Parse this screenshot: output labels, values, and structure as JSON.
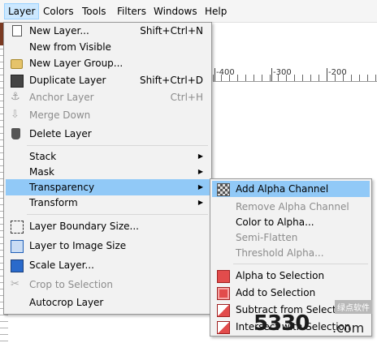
{
  "menubar": {
    "items": [
      "Layer",
      "Colors",
      "Tools",
      "Filters",
      "Windows",
      "Help"
    ]
  },
  "ruler": {
    "labels": [
      "-400",
      "-300",
      "-200"
    ]
  },
  "layer_menu": {
    "items": [
      {
        "label": "New Layer...",
        "shortcut": "Shift+Ctrl+N",
        "icon": "new-layer-icon",
        "disabled": false
      },
      {
        "label": "New from Visible",
        "shortcut": "",
        "icon": "",
        "disabled": false
      },
      {
        "label": "New Layer Group...",
        "shortcut": "",
        "icon": "folder-icon",
        "disabled": false
      },
      {
        "label": "Duplicate Layer",
        "shortcut": "Shift+Ctrl+D",
        "icon": "duplicate-layer-icon",
        "disabled": false
      },
      {
        "label": "Anchor Layer",
        "shortcut": "Ctrl+H",
        "icon": "anchor-icon",
        "disabled": true
      },
      {
        "label": "Merge Down",
        "shortcut": "",
        "icon": "merge-down-icon",
        "disabled": true
      },
      {
        "label": "Delete Layer",
        "shortcut": "",
        "icon": "trash-icon",
        "disabled": false
      },
      {
        "label": "Stack",
        "submenu": true
      },
      {
        "label": "Mask",
        "submenu": true
      },
      {
        "label": "Transparency",
        "submenu": true,
        "highlighted": true
      },
      {
        "label": "Transform",
        "submenu": true
      },
      {
        "label": "Layer Boundary Size...",
        "icon": "layer-boundary-icon"
      },
      {
        "label": "Layer to Image Size",
        "icon": "layer-to-image-icon"
      },
      {
        "label": "Scale Layer...",
        "icon": "scale-layer-icon"
      },
      {
        "label": "Crop to Selection",
        "icon": "crop-icon",
        "disabled": true
      },
      {
        "label": "Autocrop Layer"
      }
    ]
  },
  "transparency_menu": {
    "items": [
      {
        "label": "Add Alpha Channel",
        "icon": "alpha-channel-icon",
        "highlighted": true
      },
      {
        "label": "Remove Alpha Channel",
        "disabled": true
      },
      {
        "label": "Color to Alpha..."
      },
      {
        "label": "Semi-Flatten",
        "disabled": true
      },
      {
        "label": "Threshold Alpha...",
        "disabled": true
      },
      {
        "label": "Alpha to Selection",
        "icon": "alpha-to-selection-icon"
      },
      {
        "label": "Add to Selection",
        "icon": "add-to-selection-icon"
      },
      {
        "label": "Subtract from Selection",
        "icon": "subtract-selection-icon"
      },
      {
        "label": "Intersect with Selection",
        "icon": "intersect-selection-icon"
      }
    ]
  },
  "watermark": {
    "brand": "5330",
    "domain": ".com",
    "cn": "绿点软件"
  },
  "colors": {
    "highlight": "#91c9f7",
    "menubar_active": "#cce8ff",
    "disabled_text": "#8c8c8c"
  }
}
